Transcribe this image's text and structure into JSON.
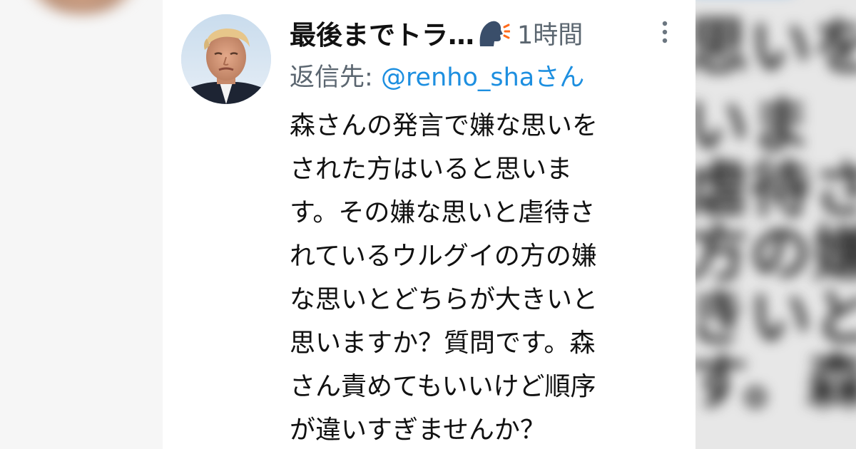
{
  "tweet": {
    "display_name": "最後までトラ…",
    "timestamp": "1時間",
    "reply_prefix": "返信先:",
    "reply_handle": "@renho_shaさん",
    "body_lines": [
      "森さんの発言で嫌な思いを",
      "された方はいると思いま",
      "す。その嫌な思いと虐待さ",
      "れているウルグイの方の嫌",
      "な思いとどちらが大きいと",
      "思いますか？質問です。森",
      "さん責めてもいいけど順序",
      "が違いすぎませんか？"
    ]
  },
  "icons": {
    "avatar": "profile-photo",
    "speaking": "speaking-head-icon",
    "more": "more-vertical-icon"
  },
  "colors": {
    "name": "#111111",
    "meta": "#5b6670",
    "link": "#1d8fe0",
    "background": "#ffffff"
  }
}
